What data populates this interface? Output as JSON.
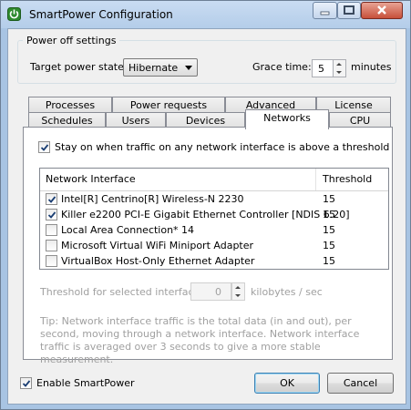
{
  "window": {
    "title": "SmartPower Configuration"
  },
  "power_off": {
    "group_title": "Power off settings",
    "target_label": "Target power state:",
    "target_value": "Hibernate",
    "grace_label": "Grace time:",
    "grace_value": "5",
    "grace_unit": "minutes"
  },
  "tabs": {
    "row1": [
      "Processes",
      "Power requests",
      "Advanced",
      "License"
    ],
    "row2": [
      "Schedules",
      "Users",
      "Devices",
      "Networks",
      "CPU"
    ],
    "active": "Networks"
  },
  "networks": {
    "stay_on_label": "Stay on when traffic on any network interface is above a threshold",
    "stay_on_checked": true,
    "columns": [
      "Network Interface",
      "Threshold"
    ],
    "rows": [
      {
        "name": "Intel[R] Centrino[R] Wireless-N 2230",
        "threshold": "15",
        "checked": true
      },
      {
        "name": "Killer e2200 PCI-E Gigabit Ethernet Controller [NDIS 6.20]",
        "threshold": "15",
        "checked": true
      },
      {
        "name": "Local Area Connection* 14",
        "threshold": "15",
        "checked": false
      },
      {
        "name": "Microsoft Virtual WiFi Miniport Adapter",
        "threshold": "15",
        "checked": false
      },
      {
        "name": "VirtualBox Host-Only Ethernet Adapter",
        "threshold": "15",
        "checked": false
      }
    ],
    "threshold_label": "Threshold for selected interface:",
    "threshold_value": "0",
    "threshold_unit": "kilobytes / sec",
    "tip": "Tip: Network interface traffic is the total data (in and out), per second, moving through a network interface. Network interface traffic is averaged over 3 seconds to give a more stable measurement."
  },
  "footer": {
    "enable_label": "Enable SmartPower",
    "enable_checked": true,
    "ok_label": "OK",
    "cancel_label": "Cancel"
  },
  "colors": {
    "title_bar": "#b9d1ea",
    "dialog_bg": "#f0f0f0",
    "close_button": "#c7503a",
    "disabled_text": "#a0a0a0"
  }
}
